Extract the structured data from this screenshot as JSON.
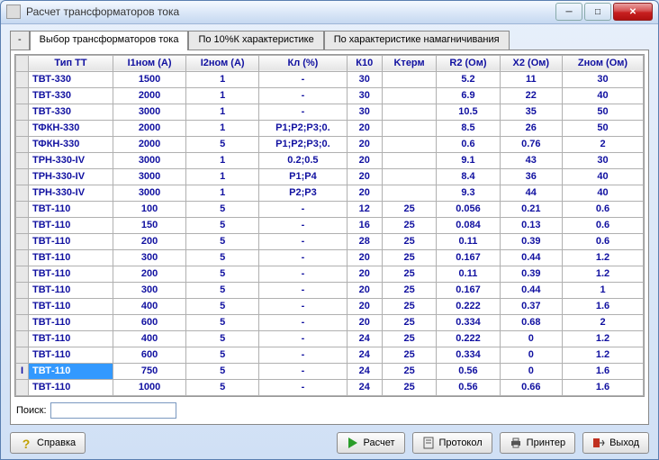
{
  "window": {
    "title": "Расчет трансформаторов тока"
  },
  "tabs": {
    "minimize": "-",
    "t1": "Выбор трансформаторов тока",
    "t2": "По 10%К характеристике",
    "t3": "По характеристике намагничивания"
  },
  "columns": {
    "c0": "",
    "c1": "Тип ТТ",
    "c2": "I1ном (А)",
    "c3": "I2ном (А)",
    "c4": "Кл (%)",
    "c5": "К10",
    "c6": "Kтерм",
    "c7": "R2 (Ом)",
    "c8": "X2 (Ом)",
    "c9": "Zном (Ом)"
  },
  "rows": [
    {
      "name": "ТВТ-330",
      "i1": "1500",
      "i2": "1",
      "kl": "-",
      "k10": "30",
      "kterm": "",
      "r2": "5.2",
      "x2": "11",
      "z": "30"
    },
    {
      "name": "ТВТ-330",
      "i1": "2000",
      "i2": "1",
      "kl": "-",
      "k10": "30",
      "kterm": "",
      "r2": "6.9",
      "x2": "22",
      "z": "40"
    },
    {
      "name": "ТВТ-330",
      "i1": "3000",
      "i2": "1",
      "kl": "-",
      "k10": "30",
      "kterm": "",
      "r2": "10.5",
      "x2": "35",
      "z": "50"
    },
    {
      "name": "ТФКН-330",
      "i1": "2000",
      "i2": "1",
      "kl": "Р1;Р2;Р3;0.",
      "k10": "20",
      "kterm": "",
      "r2": "8.5",
      "x2": "26",
      "z": "50"
    },
    {
      "name": "ТФКН-330",
      "i1": "2000",
      "i2": "5",
      "kl": "Р1;Р2;Р3;0.",
      "k10": "20",
      "kterm": "",
      "r2": "0.6",
      "x2": "0.76",
      "z": "2"
    },
    {
      "name": "ТРН-330-IV",
      "i1": "3000",
      "i2": "1",
      "kl": "0.2;0.5",
      "k10": "20",
      "kterm": "",
      "r2": "9.1",
      "x2": "43",
      "z": "30"
    },
    {
      "name": "ТРН-330-IV",
      "i1": "3000",
      "i2": "1",
      "kl": "Р1;Р4",
      "k10": "20",
      "kterm": "",
      "r2": "8.4",
      "x2": "36",
      "z": "40"
    },
    {
      "name": "ТРН-330-IV",
      "i1": "3000",
      "i2": "1",
      "kl": "Р2;Р3",
      "k10": "20",
      "kterm": "",
      "r2": "9.3",
      "x2": "44",
      "z": "40"
    },
    {
      "name": "ТВТ-110",
      "i1": "100",
      "i2": "5",
      "kl": "-",
      "k10": "12",
      "kterm": "25",
      "r2": "0.056",
      "x2": "0.21",
      "z": "0.6"
    },
    {
      "name": "ТВТ-110",
      "i1": "150",
      "i2": "5",
      "kl": "-",
      "k10": "16",
      "kterm": "25",
      "r2": "0.084",
      "x2": "0.13",
      "z": "0.6"
    },
    {
      "name": "ТВТ-110",
      "i1": "200",
      "i2": "5",
      "kl": "-",
      "k10": "28",
      "kterm": "25",
      "r2": "0.11",
      "x2": "0.39",
      "z": "0.6"
    },
    {
      "name": "ТВТ-110",
      "i1": "300",
      "i2": "5",
      "kl": "-",
      "k10": "20",
      "kterm": "25",
      "r2": "0.167",
      "x2": "0.44",
      "z": "1.2"
    },
    {
      "name": "ТВТ-110",
      "i1": "200",
      "i2": "5",
      "kl": "-",
      "k10": "20",
      "kterm": "25",
      "r2": "0.11",
      "x2": "0.39",
      "z": "1.2"
    },
    {
      "name": "ТВТ-110",
      "i1": "300",
      "i2": "5",
      "kl": "-",
      "k10": "20",
      "kterm": "25",
      "r2": "0.167",
      "x2": "0.44",
      "z": "1"
    },
    {
      "name": "ТВТ-110",
      "i1": "400",
      "i2": "5",
      "kl": "-",
      "k10": "20",
      "kterm": "25",
      "r2": "0.222",
      "x2": "0.37",
      "z": "1.6"
    },
    {
      "name": "ТВТ-110",
      "i1": "600",
      "i2": "5",
      "kl": "-",
      "k10": "20",
      "kterm": "25",
      "r2": "0.334",
      "x2": "0.68",
      "z": "2"
    },
    {
      "name": "ТВТ-110",
      "i1": "400",
      "i2": "5",
      "kl": "-",
      "k10": "24",
      "kterm": "25",
      "r2": "0.222",
      "x2": "0",
      "z": "1.2"
    },
    {
      "name": "ТВТ-110",
      "i1": "600",
      "i2": "5",
      "kl": "-",
      "k10": "24",
      "kterm": "25",
      "r2": "0.334",
      "x2": "0",
      "z": "1.2"
    },
    {
      "name": "ТВТ-110",
      "i1": "750",
      "i2": "5",
      "kl": "-",
      "k10": "24",
      "kterm": "25",
      "r2": "0.56",
      "x2": "0",
      "z": "1.6",
      "selected": true
    },
    {
      "name": "ТВТ-110",
      "i1": "1000",
      "i2": "5",
      "kl": "-",
      "k10": "24",
      "kterm": "25",
      "r2": "0.56",
      "x2": "0.66",
      "z": "1.6"
    }
  ],
  "search": {
    "label": "Поиск:",
    "value": ""
  },
  "buttons": {
    "help": "Справка",
    "calc": "Расчет",
    "protocol": "Протокол",
    "printer": "Принтер",
    "exit": "Выход"
  }
}
